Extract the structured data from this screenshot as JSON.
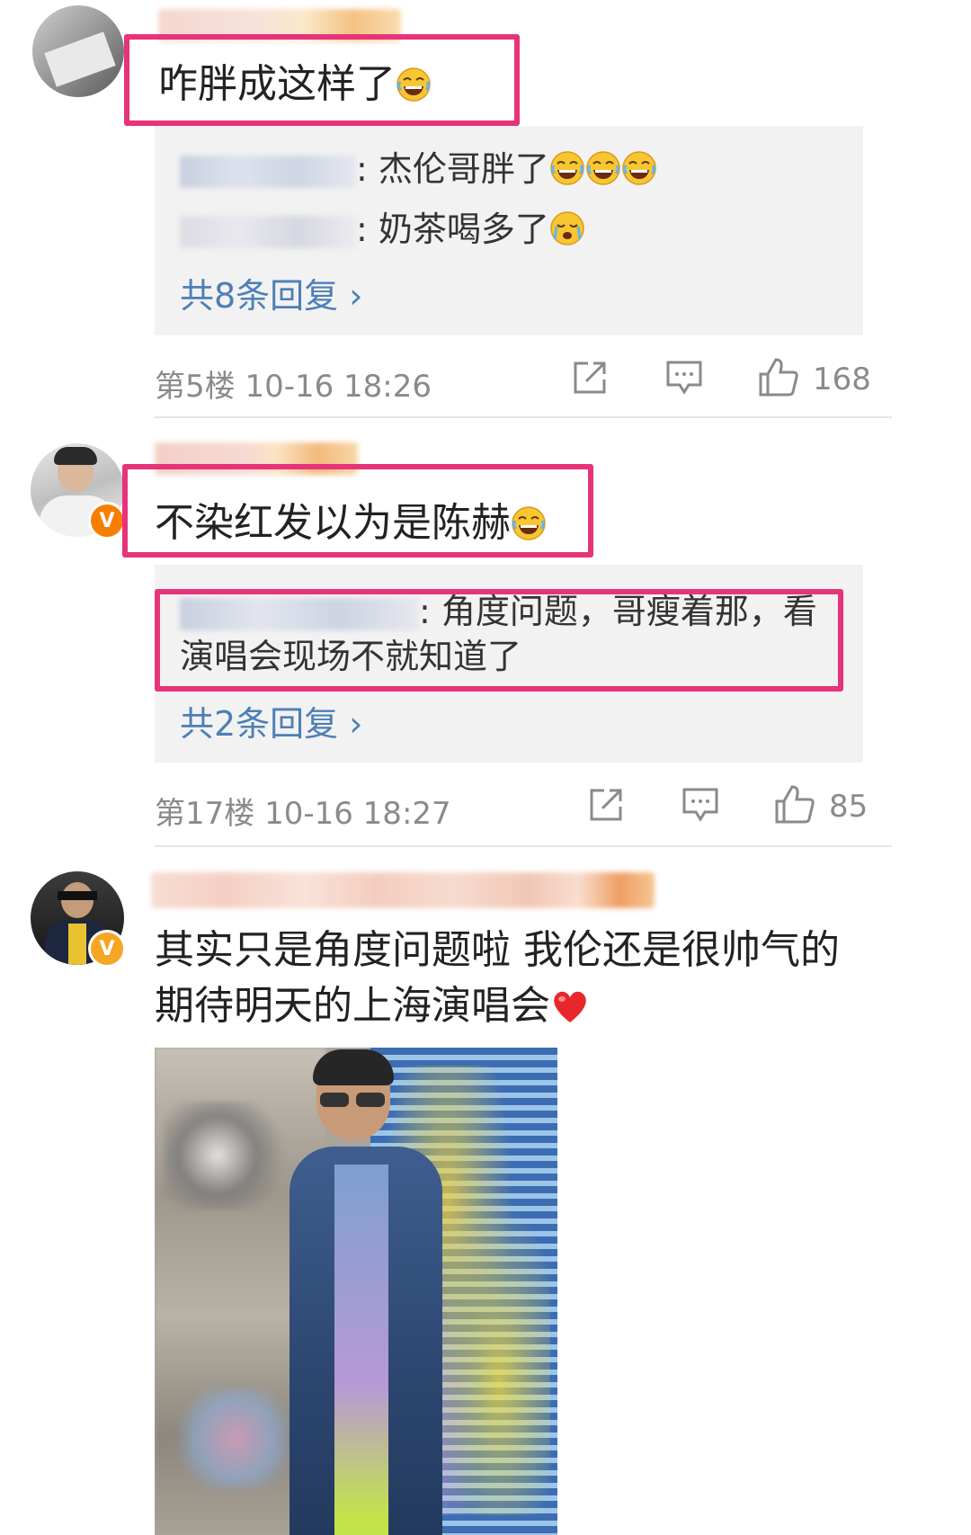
{
  "comments": [
    {
      "text": "咋胖成这样了",
      "replies": [
        {
          "text": ": 杰伦哥胖了"
        },
        {
          "text": ": 奶茶喝多了"
        }
      ],
      "more_replies": "共8条回复 ›",
      "floor_time": "第5楼  10-16 18:26",
      "likes": "168"
    },
    {
      "text": "不染红发以为是陈赫",
      "replies": [
        {
          "text": ": 角度问题，哥瘦着那，看",
          "text2": "演唱会现场不就知道了"
        }
      ],
      "more_replies": "共2条回复 ›",
      "floor_time": "第17楼  10-16 18:27",
      "likes": "85"
    },
    {
      "text_line1": "其实只是角度问题啦 我伦还是很帅气的",
      "text_line2": "期待明天的上海演唱会"
    }
  ],
  "colors": {
    "highlight": "#e6337a",
    "link": "#4d7fb7",
    "verified": "#f5a623"
  },
  "icons": [
    "share-icon",
    "comment-icon",
    "like-icon",
    "laughing-emoji",
    "heart-emoji",
    "verified-v-icon"
  ]
}
